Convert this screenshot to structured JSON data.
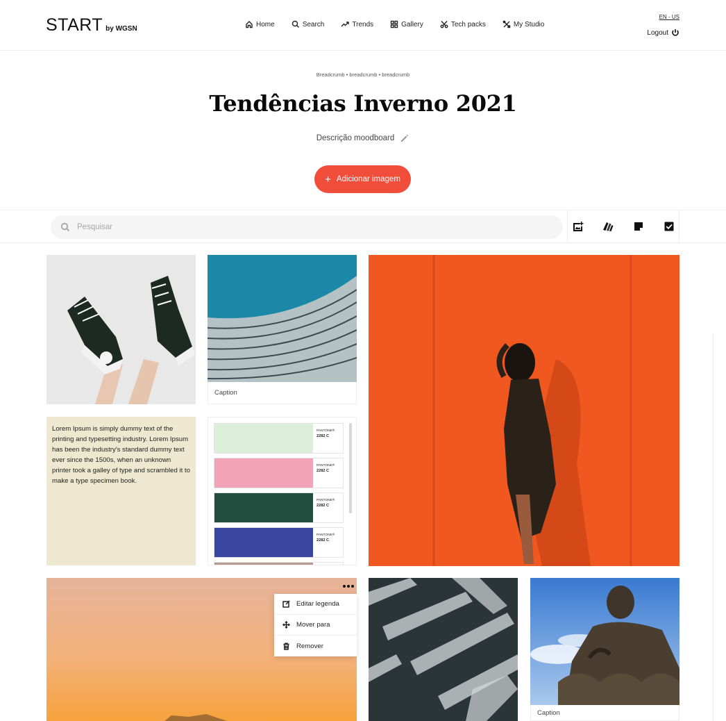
{
  "header": {
    "logo_main": "START",
    "logo_sub": "by WGSN",
    "nav": [
      {
        "label": "Home",
        "icon": "home-icon"
      },
      {
        "label": "Search",
        "icon": "search-icon"
      },
      {
        "label": "Trends",
        "icon": "trend-up-icon"
      },
      {
        "label": "Gallery",
        "icon": "grid-icon"
      },
      {
        "label": "Tech packs",
        "icon": "scissors-icon"
      },
      {
        "label": "My Studio",
        "icon": "tools-icon"
      }
    ],
    "language": "EN - US",
    "logout": "Logout"
  },
  "moodboard": {
    "breadcrumb": "Breadcrumb • breadcrumb • breadcrumb",
    "title": "Tendências Inverno 2021",
    "description": "Descrição moodboard",
    "add_button": "Adicionar imagem"
  },
  "toolbar": {
    "search_placeholder": "Pesquisar",
    "tools": [
      "add-image-icon",
      "color-swatch-icon",
      "sticky-note-icon",
      "checkbox-icon"
    ]
  },
  "cards": {
    "architecture_caption": "Caption",
    "buddha_caption": "Caption",
    "note_text": "Lorem Ipsum is simply dummy text of the printing and typesetting industry. Lorem Ipsum has been the industry's standard dummy text ever since the 1500s, when an unknown printer took a galley of type and scrambled it to make a type specimen book.",
    "palette": [
      {
        "color": "#dcefd8",
        "brand": "PANTONE®",
        "code": "2282 C"
      },
      {
        "color": "#f2a3b6",
        "brand": "PANTONE®",
        "code": "2282 C"
      },
      {
        "color": "#234d3e",
        "brand": "PANTONE®",
        "code": "2282 C"
      },
      {
        "color": "#3a47a0",
        "brand": "PANTONE®",
        "code": "2282 C"
      }
    ]
  },
  "context_menu": {
    "edit": "Editar legenda",
    "move": "Mover para",
    "remove": "Remover"
  },
  "colors": {
    "accent": "#f04d3b",
    "note_bg": "#ede8cf"
  }
}
